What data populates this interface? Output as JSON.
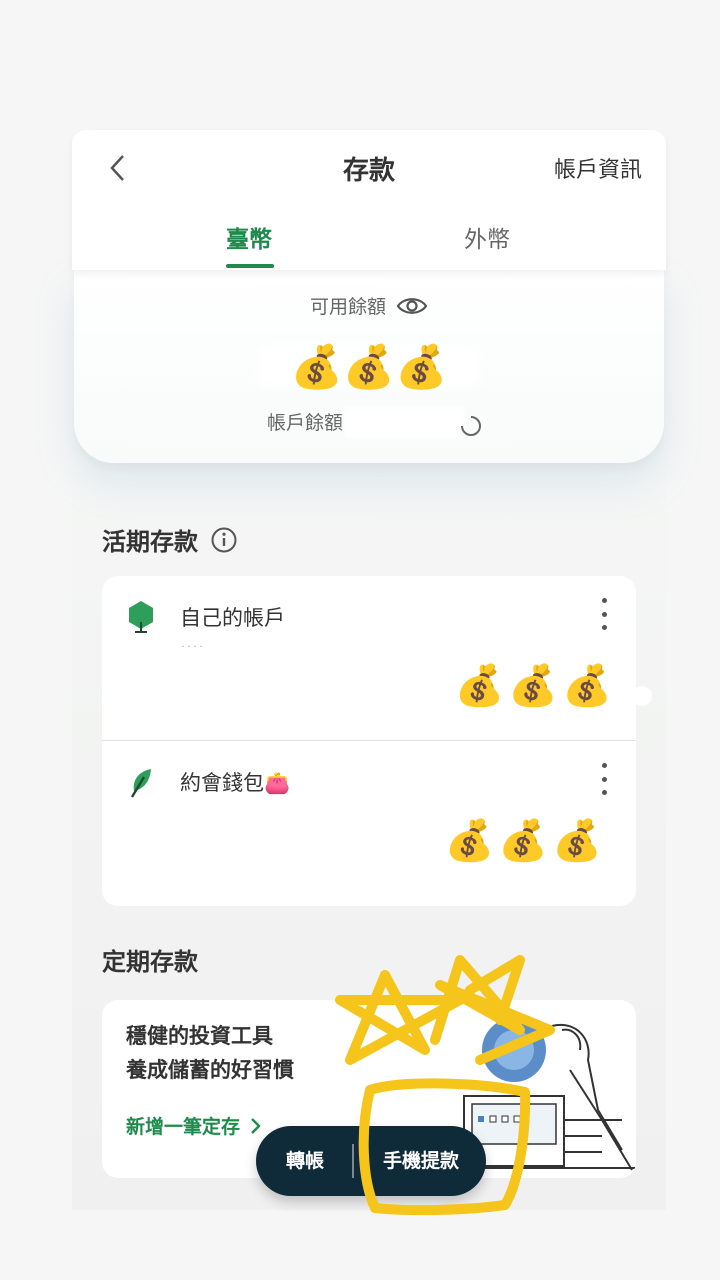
{
  "header": {
    "title": "存款",
    "account_info": "帳戶資訊",
    "tabs": [
      {
        "label": "臺幣",
        "active": true
      },
      {
        "label": "外幣",
        "active": false
      }
    ]
  },
  "balance": {
    "available_label": "可用餘額",
    "available_value": "💰💰💰",
    "account_balance_label": "帳戶餘額"
  },
  "demand": {
    "section_title": "活期存款",
    "accounts": [
      {
        "name": "自己的帳戶",
        "sub": "˙˙˙˙",
        "amount": "💰💰💰"
      },
      {
        "name": "約會錢包👛",
        "amount": "💰💰💰"
      }
    ]
  },
  "time_deposit": {
    "section_title": "定期存款",
    "line1": "穩健的投資工具",
    "line2": "養成儲蓄的好習慣",
    "link": "新增一筆定存"
  },
  "fab": {
    "transfer": "轉帳",
    "withdraw": "手機提款"
  },
  "colors": {
    "accent": "#1e8a4c",
    "fab_bg": "#0f2a38",
    "annotation": "#f5c51c"
  }
}
